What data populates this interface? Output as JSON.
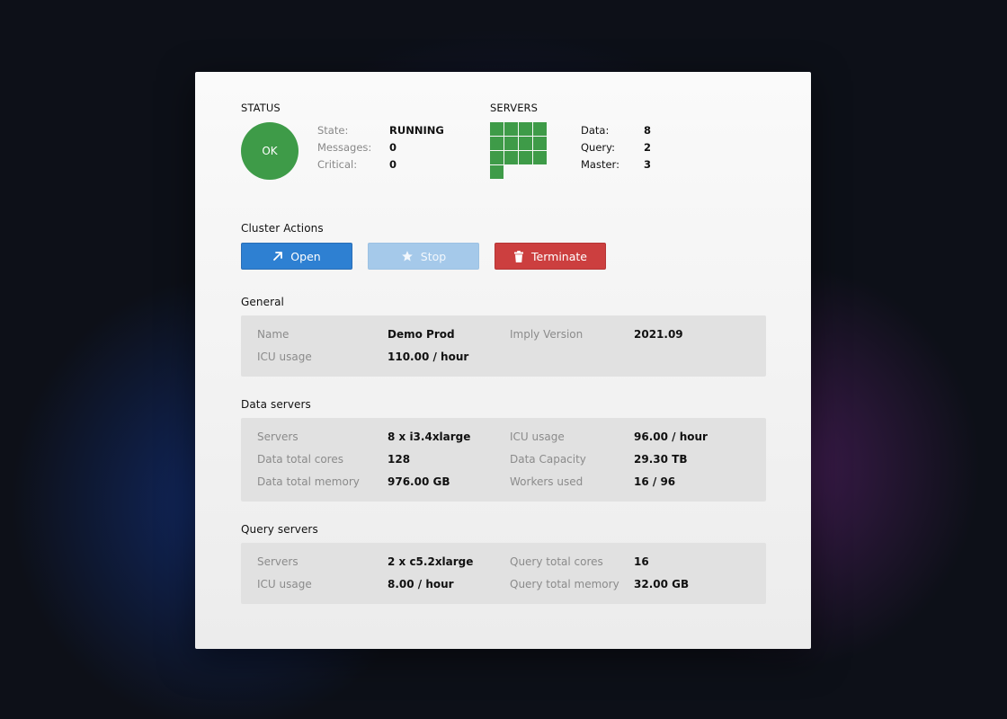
{
  "status": {
    "title": "STATUS",
    "badge": "OK",
    "items": [
      {
        "label": "State:",
        "value": "RUNNING"
      },
      {
        "label": "Messages:",
        "value": "0"
      },
      {
        "label": "Critical:",
        "value": "0"
      }
    ]
  },
  "servers": {
    "title": "SERVERS",
    "grid_color": "#3e9b48",
    "items": [
      {
        "label": "Data:",
        "value": "8"
      },
      {
        "label": "Query:",
        "value": "2"
      },
      {
        "label": "Master:",
        "value": "3"
      }
    ]
  },
  "actions": {
    "title": "Cluster Actions",
    "open": "Open",
    "stop": "Stop",
    "terminate": "Terminate"
  },
  "general": {
    "title": "General",
    "rows": [
      {
        "l1": "Name",
        "v1": "Demo Prod",
        "l2": "Imply Version",
        "v2": "2021.09"
      },
      {
        "l1": "ICU usage",
        "v1": "110.00 / hour",
        "l2": "",
        "v2": ""
      }
    ]
  },
  "data_servers": {
    "title": "Data servers",
    "rows": [
      {
        "l1": "Servers",
        "v1": "8 x i3.4xlarge",
        "l2": "ICU usage",
        "v2": "96.00 / hour"
      },
      {
        "l1": "Data total cores",
        "v1": "128",
        "l2": "Data Capacity",
        "v2": "29.30 TB"
      },
      {
        "l1": "Data total memory",
        "v1": "976.00 GB",
        "l2": "Workers used",
        "v2": "16 / 96"
      }
    ]
  },
  "query_servers": {
    "title": "Query servers",
    "rows": [
      {
        "l1": "Servers",
        "v1": "2 x c5.2xlarge",
        "l2": "Query total cores",
        "v2": "16"
      },
      {
        "l1": "ICU usage",
        "v1": "8.00 / hour",
        "l2": "Query total memory",
        "v2": "32.00 GB"
      }
    ]
  },
  "colors": {
    "ok_green": "#3e9b48",
    "open_blue": "#2e80d2",
    "stop_disabled": "#a5c9ea",
    "terminate_red": "#cc3f3f"
  }
}
